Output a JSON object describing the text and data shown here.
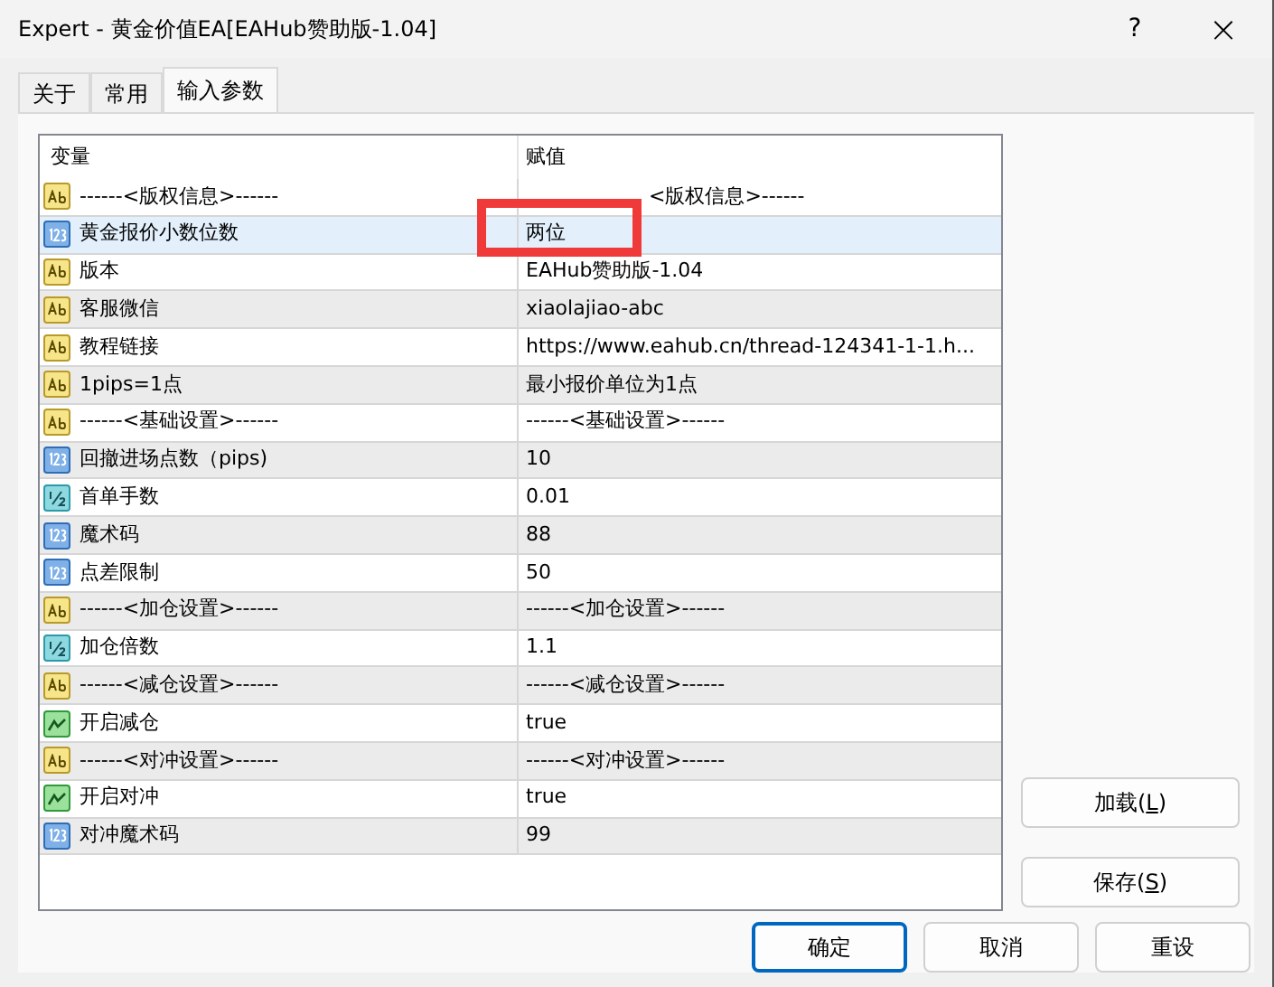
{
  "window": {
    "title": "Expert - 黄金价值EA[EAHub赞助版-1.04]",
    "help": "?",
    "close": "×"
  },
  "tabs": [
    {
      "label": "关于",
      "selected": false
    },
    {
      "label": "常用",
      "selected": false
    },
    {
      "label": "输入参数",
      "selected": true
    }
  ],
  "table": {
    "columns": [
      "变量",
      "赋值"
    ],
    "rows": [
      {
        "kind": "string",
        "name": "------<版权信息>------",
        "value": "<版权信息>------",
        "selected": false
      },
      {
        "kind": "int",
        "name": "黄金报价小数位数",
        "value": "两位",
        "selected": true
      },
      {
        "kind": "string",
        "name": "版本",
        "value": "EAHub赞助版-1.04",
        "selected": false
      },
      {
        "kind": "string",
        "name": "客服微信",
        "value": "xiaolajiao-abc",
        "selected": false
      },
      {
        "kind": "string",
        "name": "教程链接",
        "value": "https://www.eahub.cn/thread-124341-1-1.h...",
        "selected": false
      },
      {
        "kind": "string",
        "name": "1pips=1点",
        "value": "最小报价单位为1点",
        "selected": false
      },
      {
        "kind": "string",
        "name": "------<基础设置>------",
        "value": "------<基础设置>------",
        "selected": false
      },
      {
        "kind": "int",
        "name": "回撤进场点数（pips)",
        "value": "10",
        "selected": false
      },
      {
        "kind": "double",
        "name": "首单手数",
        "value": "0.01",
        "selected": false
      },
      {
        "kind": "int",
        "name": "魔术码",
        "value": "88",
        "selected": false
      },
      {
        "kind": "int",
        "name": "点差限制",
        "value": "50",
        "selected": false
      },
      {
        "kind": "string",
        "name": "------<加仓设置>------",
        "value": "------<加仓设置>------",
        "selected": false
      },
      {
        "kind": "double",
        "name": "加仓倍数",
        "value": "1.1",
        "selected": false
      },
      {
        "kind": "string",
        "name": "------<减仓设置>------",
        "value": "------<减仓设置>------",
        "selected": false
      },
      {
        "kind": "bool",
        "name": "开启减仓",
        "value": "true",
        "selected": false
      },
      {
        "kind": "string",
        "name": "------<对冲设置>------",
        "value": "------<对冲设置>------",
        "selected": false
      },
      {
        "kind": "bool",
        "name": "开启对冲",
        "value": "true",
        "selected": false
      },
      {
        "kind": "int",
        "name": "对冲魔术码",
        "value": "99",
        "selected": false
      }
    ]
  },
  "annotation": {
    "kind": "highlight_box"
  },
  "side_buttons": [
    {
      "prefix": "加载(",
      "hotkey": "L",
      "suffix": ")"
    },
    {
      "prefix": "保存(",
      "hotkey": "S",
      "suffix": ")"
    }
  ],
  "buttons": [
    {
      "label": "确定",
      "default": true
    },
    {
      "label": "取消",
      "default": false
    },
    {
      "label": "重设",
      "default": false
    }
  ]
}
